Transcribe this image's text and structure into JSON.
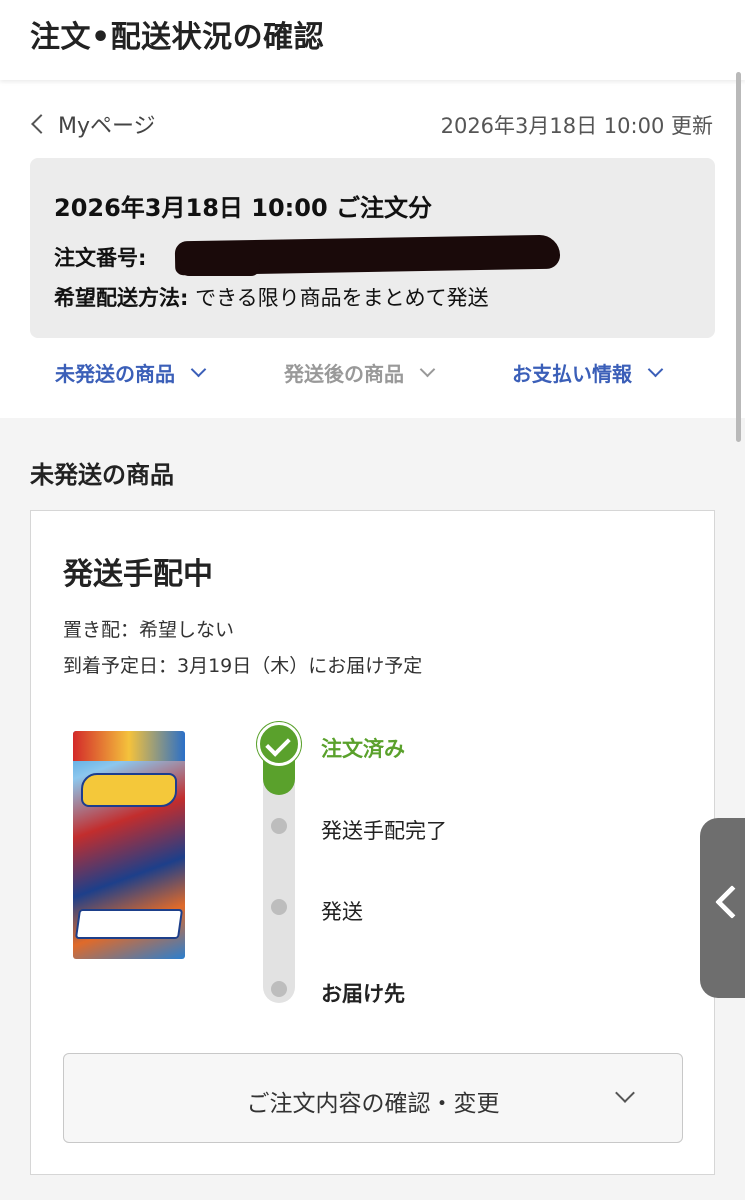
{
  "header": {
    "title": "注文•配送状況の確認"
  },
  "nav": {
    "back_label": "Myページ",
    "updated_text": "2026年3月18日 10:00 更新"
  },
  "order": {
    "date_text": "2026年3月18日 10:00 ご注文分",
    "number_label": "注文番号:",
    "method_label": "希望配送方法:",
    "method_value": "できる限り商品をまとめて発送"
  },
  "tabs": [
    {
      "label": "未発送の商品",
      "color": "#3b5fb8"
    },
    {
      "label": "発送後の商品",
      "color": "#999999"
    },
    {
      "label": "お支払い情報",
      "color": "#3b5fb8"
    }
  ],
  "section": {
    "title": "未発送の商品"
  },
  "card": {
    "status": "発送手配中",
    "line1": "置き配：希望しない",
    "line2": "到着予定日：3月19日（木）にお届け予定",
    "product_icon": "pokemon-card-pack-image",
    "steps": [
      {
        "label": "注文済み",
        "state": "done"
      },
      {
        "label": "発送手配完了",
        "state": "pending"
      },
      {
        "label": "発送",
        "state": "pending"
      },
      {
        "label": "お届け先",
        "state": "pending"
      }
    ],
    "confirm_label": "ご注文内容の確認・変更"
  },
  "colors": {
    "accent": "#3b5fb8",
    "success": "#5aa12c"
  }
}
